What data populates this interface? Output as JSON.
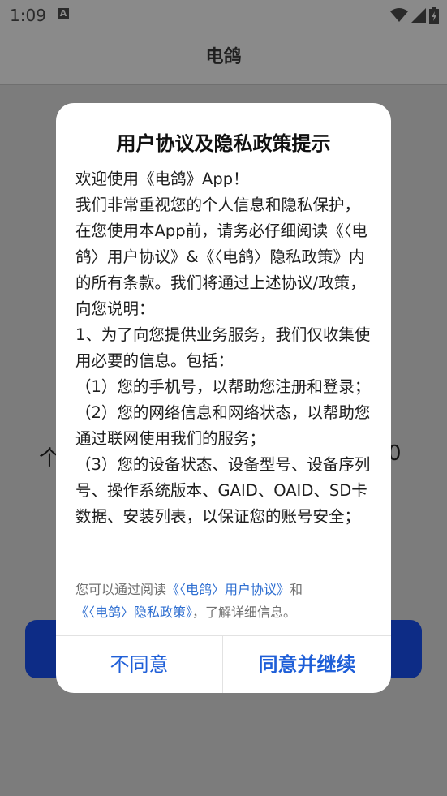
{
  "status": {
    "time": "1:09"
  },
  "app": {
    "title": "电鸽"
  },
  "background": {
    "left_char": "个",
    "right_char": "0"
  },
  "dialog": {
    "title": "用户协议及隐私政策提示",
    "paragraphs": [
      "欢迎使用《电鸽》App！",
      "我们非常重视您的个人信息和隐私保护，在您使用本App前，请务必仔细阅读《〈电鸽〉用户协议》&《〈电鸽〉隐私政策》内的所有条款。我们将通过上述协议/政策，向您说明：",
      "1、为了向您提供业务服务，我们仅收集使用必要的信息。包括：",
      "（1）您的手机号，以帮助您注册和登录；",
      "（2）您的网络信息和网络状态，以帮助您通过联网使用我们的服务；",
      "（3）您的设备状态、设备型号、设备序列号、操作系统版本、GAID、OAID、SD卡数据、安装列表，以保证您的账号安全；"
    ],
    "notice": {
      "prefix": "您可以通过阅读",
      "link1": "《〈电鸽〉用户协议》",
      "middle": "和",
      "link2": "《〈电鸽〉隐私政策》",
      "suffix": "，了解详细信息。"
    },
    "disagree_label": "不同意",
    "agree_label": "同意并继续"
  },
  "colors": {
    "link": "#2f6fd1",
    "scrim": "#7c7c7c",
    "primary": "#0d2c86"
  }
}
